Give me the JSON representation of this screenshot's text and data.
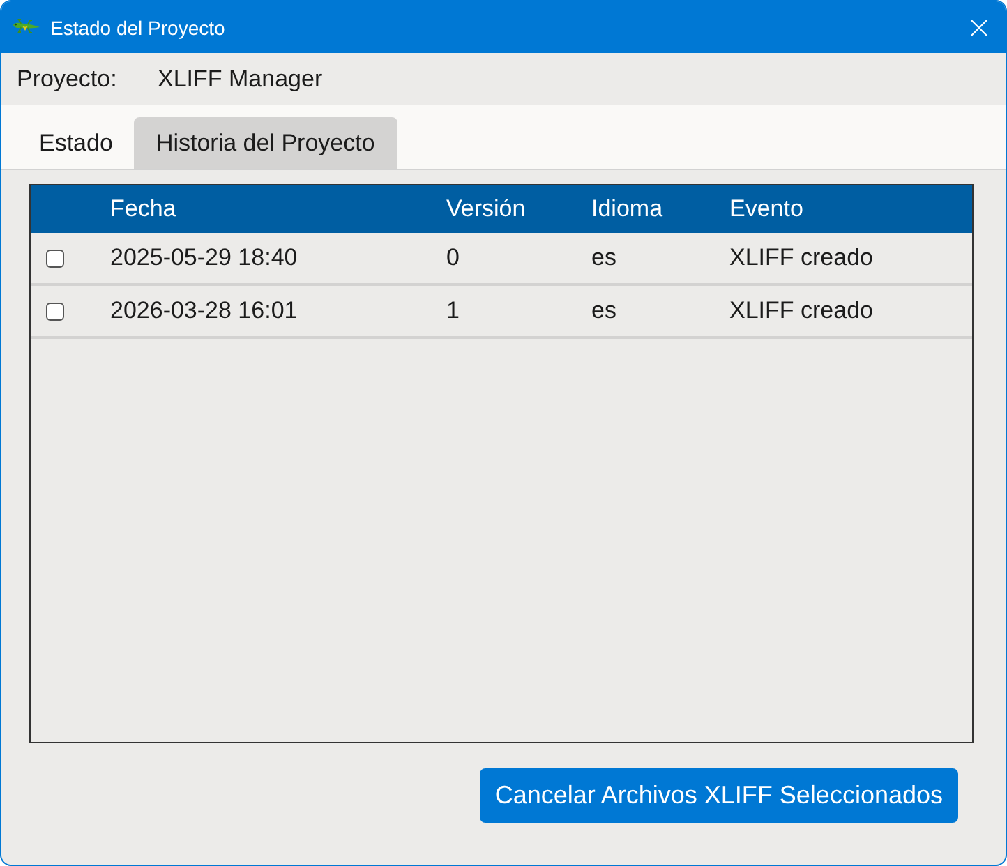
{
  "window": {
    "title": "Estado del Proyecto"
  },
  "project": {
    "label": "Proyecto:",
    "value": "XLIFF Manager"
  },
  "tabs": [
    {
      "label": "Estado",
      "selected": false
    },
    {
      "label": "Historia del Proyecto",
      "selected": true
    }
  ],
  "table": {
    "columns": [
      {
        "label": "Fecha"
      },
      {
        "label": "Versión"
      },
      {
        "label": "Idioma"
      },
      {
        "label": "Evento"
      }
    ],
    "rows": [
      {
        "checked": false,
        "cells": [
          "2025-05-29 18:40",
          "0",
          "es",
          "XLIFF creado"
        ]
      },
      {
        "checked": false,
        "cells": [
          "2026-03-28 16:01",
          "1",
          "es",
          "XLIFF creado"
        ]
      }
    ]
  },
  "action_button": {
    "label": "Cancelar Archivos XLIFF Seleccionados"
  }
}
